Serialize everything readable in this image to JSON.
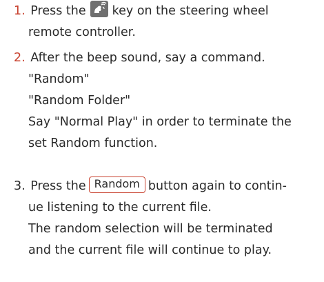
{
  "step1": {
    "number": "1.",
    "text_before_icon": "Press the",
    "text_after_icon": "key on the steering wheel",
    "continuation": "remote controller.",
    "icon": "voice-command-icon"
  },
  "step2": {
    "number": "2.",
    "text": "After the beep sound, say a command.",
    "commands": [
      "\"Random\"",
      "\"Random Folder\""
    ],
    "note_line1": "Say \"Normal Play\" in order to terminate the",
    "note_line2": "set Random function."
  },
  "step3": {
    "number": "3.",
    "text_before_button": "Press the",
    "button_label": "Random",
    "text_after_button": "button again to contin-",
    "continuation": "ue listening to the current file.",
    "note_line1": "The random selection will be terminated",
    "note_line2": "and the current file will continue to play."
  },
  "colors": {
    "step_number_red": "#c8412e",
    "text": "#2a2a2a",
    "icon_bg": "#6f6f6f",
    "button_border": "#c8412e"
  }
}
